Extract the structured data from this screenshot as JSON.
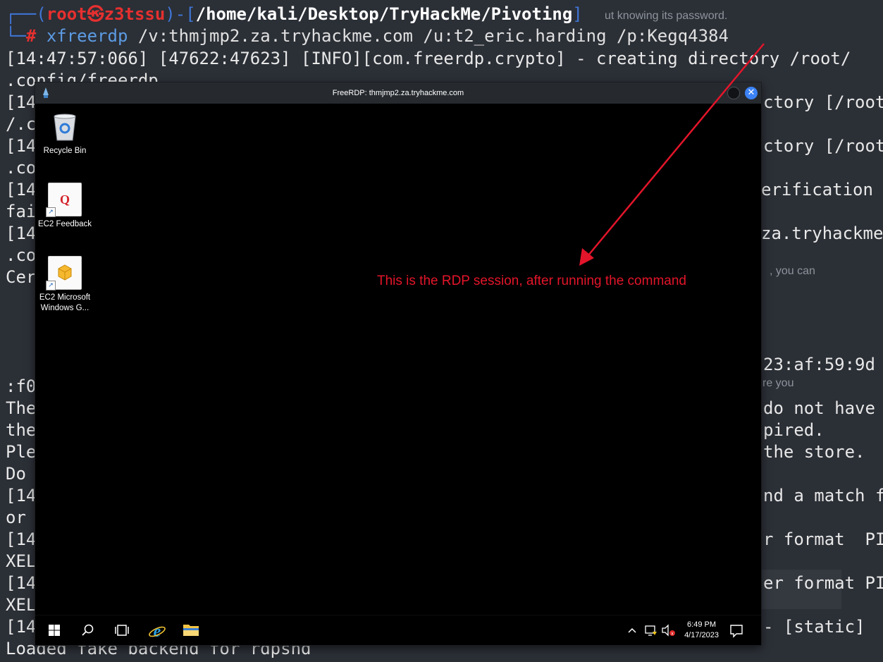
{
  "background_doc": {
    "line1": "ut knowing its password.",
    "line2": ", you can",
    "line3": "re you"
  },
  "terminal": {
    "prompt": {
      "corner_top": "┌──(",
      "user": "root㉿z3tssu",
      "sep": ")-[",
      "cwd": "/home/kali/Desktop/TryHackMe/Pivoting",
      "close": "]",
      "corner_bottom": "└─",
      "hash": "#",
      "command": "xfreerdp",
      "args": " /v:thmjmp2.za.tryhackme.com /u:t2_eric.harding /p:Kegq4384"
    },
    "lines": [
      "[14:47:57:066] [47622:47623] [INFO][com.freerdp.crypto] - creating directory /root/",
      ".config/freerdp",
      "[14",
      "ctory [/root",
      "/.c",
      "[14",
      "ctory [/root/",
      ".co",
      "[14",
      "erification",
      "fai",
      "[14",
      "za.tryhackme",
      ".co",
      "Cer",
      "23:af:59:9d",
      ":f0",
      "The",
      "do not have",
      "the",
      "pired.",
      "Ple",
      "the store.",
      "Do",
      "[14",
      "nd a match f",
      "or",
      "[14",
      "r format  PI",
      "XEL",
      "[14",
      "er format PI",
      "XEL",
      "[14",
      "- [static]",
      "Loaded fake backend for rdpsnd"
    ]
  },
  "rdp_window": {
    "title": "FreeRDP: thmjmp2.za.tryhackme.com",
    "close_glyph": "✕",
    "desktop_icons": [
      {
        "label": "Recycle Bin"
      },
      {
        "label": "EC2 Feedback"
      },
      {
        "label": "EC2 Microsoft Windows G..."
      }
    ],
    "taskbar": {
      "time": "6:49 PM",
      "date": "4/17/2023"
    }
  },
  "annotation": {
    "text": "This is the RDP session, after running the command",
    "color": "#e3152a"
  },
  "colors": {
    "prompt_blue": "#3f76d6",
    "prompt_red": "#e6302f",
    "command_blue": "#5c9be3",
    "terminal_bg": "#2b2f36",
    "close_button": "#3b82f6"
  }
}
